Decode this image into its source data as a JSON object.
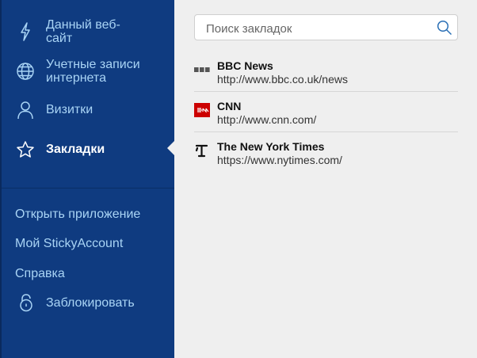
{
  "sidebar": {
    "items": [
      {
        "label": "Данный веб-\nсайт",
        "icon": "lightning-icon"
      },
      {
        "label": "Учетные записи\nинтернета",
        "icon": "globe-icon"
      },
      {
        "label": "Визитки",
        "icon": "person-icon"
      },
      {
        "label": "Закладки",
        "icon": "star-icon",
        "active": true
      }
    ],
    "links": [
      {
        "label": "Открыть приложение"
      },
      {
        "label": "Мой StickyAccount"
      },
      {
        "label": "Справка"
      }
    ],
    "lock": {
      "label": "Заблокировать",
      "icon": "lock-icon"
    }
  },
  "search": {
    "placeholder": "Поиск закладок",
    "value": ""
  },
  "bookmarks": [
    {
      "title": "BBC News",
      "url": "http://www.bbc.co.uk/news",
      "logo": "bbc-logo-icon"
    },
    {
      "title": "CNN",
      "url": "http://www.cnn.com/",
      "logo": "cnn-logo-icon"
    },
    {
      "title": "The New York Times",
      "url": "https://www.nytimes.com/",
      "logo": "nyt-logo-icon"
    }
  ],
  "colors": {
    "sidebar": "#0f3b80",
    "sidebar_text": "#a9d4f5",
    "active_text": "#ffffff",
    "content_bg": "#efefef",
    "cnn_red": "#cc0000"
  }
}
